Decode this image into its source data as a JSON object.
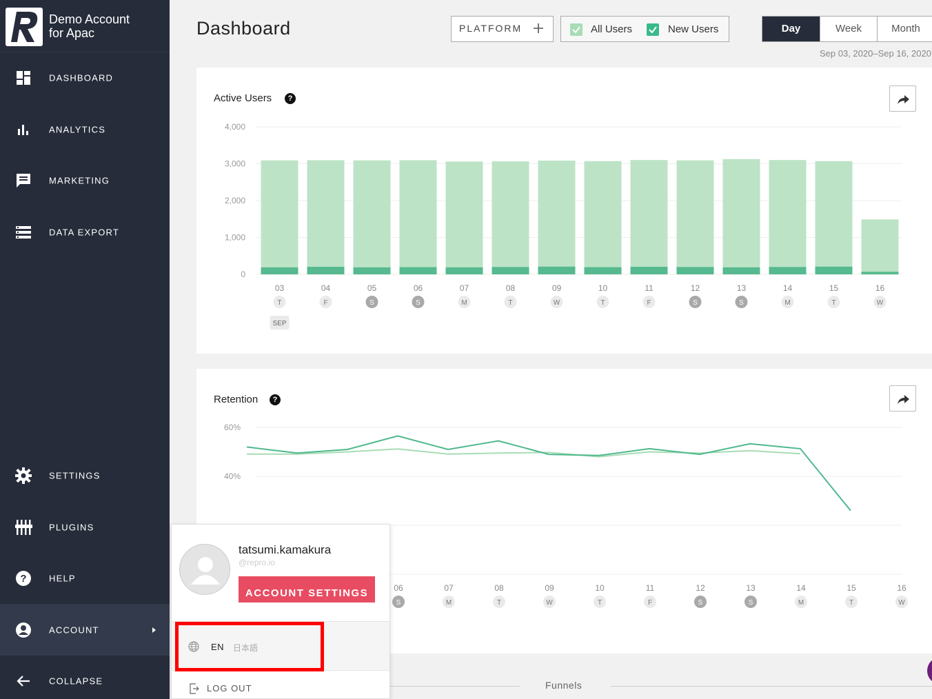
{
  "brand": {
    "line1": "Demo Account",
    "line2": "for Apac"
  },
  "sidebar": {
    "items": [
      {
        "label": "DASHBOARD",
        "icon": "dashboard-icon"
      },
      {
        "label": "ANALYTICS",
        "icon": "analytics-icon"
      },
      {
        "label": "MARKETING",
        "icon": "marketing-icon"
      },
      {
        "label": "DATA EXPORT",
        "icon": "data-export-icon"
      }
    ],
    "bottom_items": [
      {
        "label": "SETTINGS",
        "icon": "gear-icon"
      },
      {
        "label": "PLUGINS",
        "icon": "plugins-icon"
      },
      {
        "label": "HELP",
        "icon": "help-icon"
      },
      {
        "label": "ACCOUNT",
        "icon": "account-icon"
      },
      {
        "label": "COLLAPSE",
        "icon": "arrow-left-icon"
      }
    ]
  },
  "header": {
    "title": "Dashboard",
    "platform_label": "PLATFORM",
    "filters": [
      {
        "label": "All Users",
        "checked": true,
        "color": "#a8dcb5"
      },
      {
        "label": "New Users",
        "checked": true,
        "color": "#3ab98b"
      }
    ],
    "periods": [
      "Day",
      "Week",
      "Month"
    ],
    "active_period": "Day",
    "date_range": "Sep 03, 2020–Sep 16, 2020"
  },
  "active_users_card": {
    "title": "Active Users"
  },
  "retention_card": {
    "title": "Retention"
  },
  "chart_data": [
    {
      "type": "bar",
      "title": "Active Users",
      "categories": [
        "03",
        "04",
        "05",
        "06",
        "07",
        "08",
        "09",
        "10",
        "11",
        "12",
        "13",
        "14",
        "15",
        "16"
      ],
      "weekdays": [
        "T",
        "F",
        "S",
        "S",
        "M",
        "T",
        "W",
        "T",
        "F",
        "S",
        "S",
        "M",
        "T",
        "W"
      ],
      "month_label": "SEP",
      "yticks": [
        "4,000",
        "3,000",
        "2,000",
        "1,000",
        "0"
      ],
      "ylim": [
        0,
        4000
      ],
      "series": [
        {
          "name": "All Users",
          "color": "#bde3c6",
          "values": [
            3090,
            3095,
            3090,
            3095,
            3060,
            3065,
            3085,
            3070,
            3100,
            3090,
            3125,
            3100,
            3070,
            1490
          ]
        },
        {
          "name": "New Users",
          "color": "#56b98f",
          "values": [
            190,
            205,
            190,
            195,
            190,
            200,
            210,
            195,
            205,
            200,
            190,
            200,
            210,
            70
          ]
        }
      ]
    },
    {
      "type": "line",
      "title": "Retention",
      "categories": [
        "06",
        "07",
        "08",
        "09",
        "10",
        "11",
        "12",
        "13",
        "14",
        "15",
        "16"
      ],
      "weekdays": [
        "S",
        "M",
        "T",
        "W",
        "T",
        "F",
        "S",
        "S",
        "M",
        "T",
        "W"
      ],
      "yticks": [
        "60%",
        "40%"
      ],
      "ylim": [
        20,
        60
      ],
      "series": [
        {
          "name": "All Users",
          "color": "#a8dcb5",
          "values": [
            49.1,
            49.1,
            50.0,
            51.2,
            49.1,
            49.5,
            49.8,
            48.0,
            50.0,
            49.5,
            50.5,
            49.2
          ]
        },
        {
          "name": "New Users",
          "color": "#4db88c",
          "values": [
            52.0,
            49.5,
            51.0,
            56.5,
            51.0,
            54.5,
            49.0,
            48.5,
            51.3,
            49.0,
            53.3,
            51.3,
            26.0
          ]
        }
      ]
    }
  ],
  "popup": {
    "username": "tatsumi.kamakura",
    "email": "@repro.io",
    "account_settings": "ACCOUNT SETTINGS",
    "lang_en": "EN",
    "lang_ja": "日本語",
    "logout": "LOG OUT"
  },
  "footer": {
    "funnels": "Funnels"
  }
}
